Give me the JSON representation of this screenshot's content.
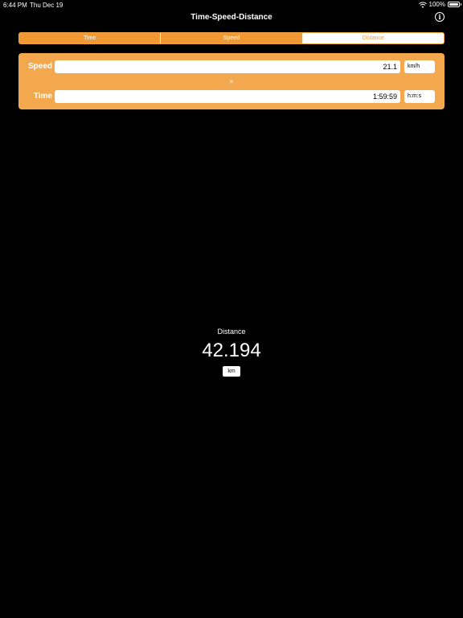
{
  "status_bar": {
    "time": "6:44 PM",
    "date": "Thu Dec 19",
    "battery": "100%"
  },
  "nav": {
    "title": "Time-Speed-Distance",
    "info_glyph": "i"
  },
  "tabs": [
    {
      "label": "Time",
      "selected": false
    },
    {
      "label": "Speed",
      "selected": false
    },
    {
      "label": "Distance",
      "selected": true
    }
  ],
  "inputs": {
    "speed": {
      "label": "Speed",
      "value": "21.1",
      "unit": "km/h"
    },
    "operator": "×",
    "time": {
      "label": "Time",
      "value": "1:59:59",
      "unit": "h:m:s"
    }
  },
  "result": {
    "label": "Distance",
    "value": "42.194",
    "unit": "km"
  },
  "colors": {
    "accent": "#f19a35",
    "card": "#f4a84d",
    "background": "#000000"
  }
}
